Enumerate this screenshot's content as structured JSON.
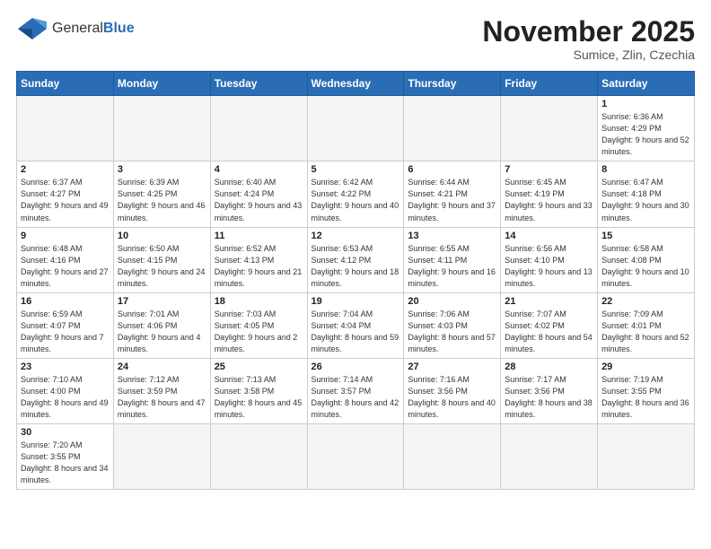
{
  "logo": {
    "text_general": "General",
    "text_blue": "Blue"
  },
  "title": "November 2025",
  "subtitle": "Sumice, Zlin, Czechia",
  "weekdays": [
    "Sunday",
    "Monday",
    "Tuesday",
    "Wednesday",
    "Thursday",
    "Friday",
    "Saturday"
  ],
  "weeks": [
    [
      {
        "day": "",
        "info": ""
      },
      {
        "day": "",
        "info": ""
      },
      {
        "day": "",
        "info": ""
      },
      {
        "day": "",
        "info": ""
      },
      {
        "day": "",
        "info": ""
      },
      {
        "day": "",
        "info": ""
      },
      {
        "day": "1",
        "info": "Sunrise: 6:36 AM\nSunset: 4:29 PM\nDaylight: 9 hours and 52 minutes."
      }
    ],
    [
      {
        "day": "2",
        "info": "Sunrise: 6:37 AM\nSunset: 4:27 PM\nDaylight: 9 hours and 49 minutes."
      },
      {
        "day": "3",
        "info": "Sunrise: 6:39 AM\nSunset: 4:25 PM\nDaylight: 9 hours and 46 minutes."
      },
      {
        "day": "4",
        "info": "Sunrise: 6:40 AM\nSunset: 4:24 PM\nDaylight: 9 hours and 43 minutes."
      },
      {
        "day": "5",
        "info": "Sunrise: 6:42 AM\nSunset: 4:22 PM\nDaylight: 9 hours and 40 minutes."
      },
      {
        "day": "6",
        "info": "Sunrise: 6:44 AM\nSunset: 4:21 PM\nDaylight: 9 hours and 37 minutes."
      },
      {
        "day": "7",
        "info": "Sunrise: 6:45 AM\nSunset: 4:19 PM\nDaylight: 9 hours and 33 minutes."
      },
      {
        "day": "8",
        "info": "Sunrise: 6:47 AM\nSunset: 4:18 PM\nDaylight: 9 hours and 30 minutes."
      }
    ],
    [
      {
        "day": "9",
        "info": "Sunrise: 6:48 AM\nSunset: 4:16 PM\nDaylight: 9 hours and 27 minutes."
      },
      {
        "day": "10",
        "info": "Sunrise: 6:50 AM\nSunset: 4:15 PM\nDaylight: 9 hours and 24 minutes."
      },
      {
        "day": "11",
        "info": "Sunrise: 6:52 AM\nSunset: 4:13 PM\nDaylight: 9 hours and 21 minutes."
      },
      {
        "day": "12",
        "info": "Sunrise: 6:53 AM\nSunset: 4:12 PM\nDaylight: 9 hours and 18 minutes."
      },
      {
        "day": "13",
        "info": "Sunrise: 6:55 AM\nSunset: 4:11 PM\nDaylight: 9 hours and 16 minutes."
      },
      {
        "day": "14",
        "info": "Sunrise: 6:56 AM\nSunset: 4:10 PM\nDaylight: 9 hours and 13 minutes."
      },
      {
        "day": "15",
        "info": "Sunrise: 6:58 AM\nSunset: 4:08 PM\nDaylight: 9 hours and 10 minutes."
      }
    ],
    [
      {
        "day": "16",
        "info": "Sunrise: 6:59 AM\nSunset: 4:07 PM\nDaylight: 9 hours and 7 minutes."
      },
      {
        "day": "17",
        "info": "Sunrise: 7:01 AM\nSunset: 4:06 PM\nDaylight: 9 hours and 4 minutes."
      },
      {
        "day": "18",
        "info": "Sunrise: 7:03 AM\nSunset: 4:05 PM\nDaylight: 9 hours and 2 minutes."
      },
      {
        "day": "19",
        "info": "Sunrise: 7:04 AM\nSunset: 4:04 PM\nDaylight: 8 hours and 59 minutes."
      },
      {
        "day": "20",
        "info": "Sunrise: 7:06 AM\nSunset: 4:03 PM\nDaylight: 8 hours and 57 minutes."
      },
      {
        "day": "21",
        "info": "Sunrise: 7:07 AM\nSunset: 4:02 PM\nDaylight: 8 hours and 54 minutes."
      },
      {
        "day": "22",
        "info": "Sunrise: 7:09 AM\nSunset: 4:01 PM\nDaylight: 8 hours and 52 minutes."
      }
    ],
    [
      {
        "day": "23",
        "info": "Sunrise: 7:10 AM\nSunset: 4:00 PM\nDaylight: 8 hours and 49 minutes."
      },
      {
        "day": "24",
        "info": "Sunrise: 7:12 AM\nSunset: 3:59 PM\nDaylight: 8 hours and 47 minutes."
      },
      {
        "day": "25",
        "info": "Sunrise: 7:13 AM\nSunset: 3:58 PM\nDaylight: 8 hours and 45 minutes."
      },
      {
        "day": "26",
        "info": "Sunrise: 7:14 AM\nSunset: 3:57 PM\nDaylight: 8 hours and 42 minutes."
      },
      {
        "day": "27",
        "info": "Sunrise: 7:16 AM\nSunset: 3:56 PM\nDaylight: 8 hours and 40 minutes."
      },
      {
        "day": "28",
        "info": "Sunrise: 7:17 AM\nSunset: 3:56 PM\nDaylight: 8 hours and 38 minutes."
      },
      {
        "day": "29",
        "info": "Sunrise: 7:19 AM\nSunset: 3:55 PM\nDaylight: 8 hours and 36 minutes."
      }
    ],
    [
      {
        "day": "30",
        "info": "Sunrise: 7:20 AM\nSunset: 3:55 PM\nDaylight: 8 hours and 34 minutes."
      },
      {
        "day": "",
        "info": ""
      },
      {
        "day": "",
        "info": ""
      },
      {
        "day": "",
        "info": ""
      },
      {
        "day": "",
        "info": ""
      },
      {
        "day": "",
        "info": ""
      },
      {
        "day": "",
        "info": ""
      }
    ]
  ]
}
